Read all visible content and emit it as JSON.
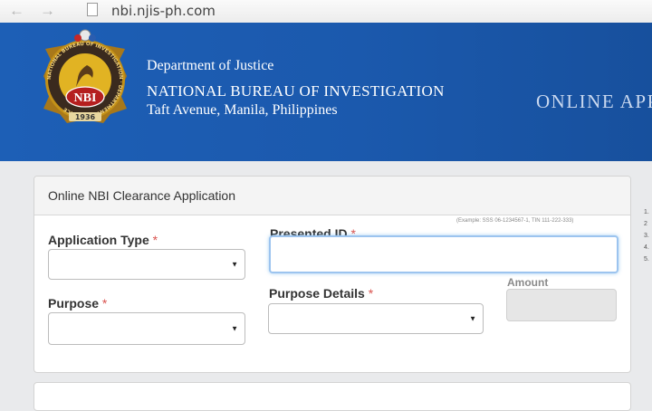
{
  "browser": {
    "url": "nbi.njis-ph.com",
    "back_icon": "arrow-left-icon",
    "forward_icon": "arrow-right-icon",
    "page_icon": "page-icon"
  },
  "header": {
    "seal": {
      "text": "NBI",
      "year": "1936",
      "ring_text": "NATIONAL BUREAU OF INVESTIGATION · DEPARTMENT OF JUSTICE"
    },
    "department": "Department of Justice",
    "bureau": "NATIONAL BUREAU OF INVESTIGATION",
    "address": "Taft Avenue, Manila, Philippines",
    "banner": "ONLINE APPL"
  },
  "form": {
    "title": "Online NBI Clearance Application",
    "required_marker": "*",
    "application_type": {
      "label": "Application Type",
      "value": ""
    },
    "presented_id": {
      "label": "Presented ID",
      "hint": "(Example: SSS 06-1234567-1, TIN 111-222-333)",
      "value": ""
    },
    "purpose": {
      "label": "Purpose",
      "value": ""
    },
    "purpose_details": {
      "label": "Purpose Details",
      "value": ""
    },
    "amount": {
      "label": "Amount",
      "value": ""
    }
  },
  "side_notes": [
    "1.",
    "2",
    "3.",
    "4.",
    "5."
  ],
  "colors": {
    "header_blue": "#1b59ad",
    "required": "#d9534f"
  }
}
